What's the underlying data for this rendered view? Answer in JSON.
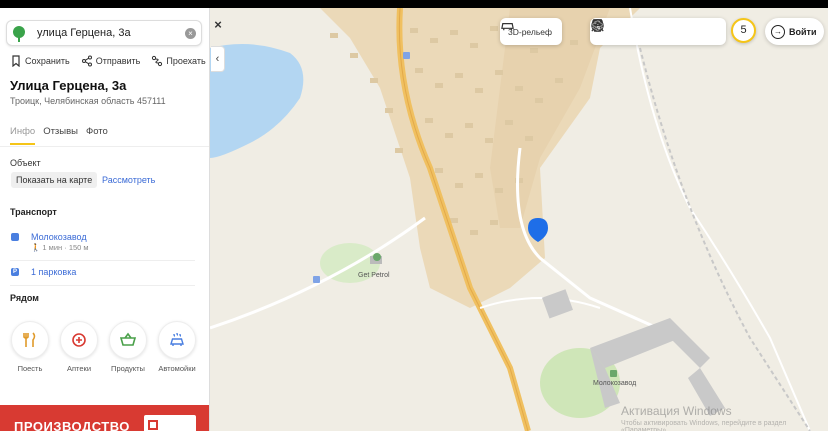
{
  "search": {
    "value": "улица Герцена, 3а"
  },
  "actions": {
    "save": "Сохранить",
    "share": "Отправить",
    "route": "Проехать"
  },
  "place": {
    "title": "Улица Герцена, 3а",
    "address": "Троицк, Челябинская область   457111"
  },
  "tabs": [
    "Инфо",
    "Отзывы",
    "Фото"
  ],
  "object": {
    "label": "Объект",
    "show_on_map": "Показать на карте",
    "route_link": "Рассмотреть"
  },
  "transport": {
    "title": "Транспорт",
    "stop_name": "Молокозавод",
    "stop_meta": "🚶 1 мин · 150 м",
    "parking": "1 парковка"
  },
  "nearby": {
    "title": "Рядом",
    "categories": [
      {
        "label": "Поесть",
        "icon": "food-icon"
      },
      {
        "label": "Аптеки",
        "icon": "pharmacy-icon"
      },
      {
        "label": "Продукты",
        "icon": "basket-icon"
      },
      {
        "label": "Автомойки",
        "icon": "carwash-icon"
      }
    ]
  },
  "ad": {
    "text": "ПРОИЗВОДСТВО"
  },
  "map_controls": {
    "relief": "3D-рельеф",
    "badge": "5",
    "login": "Войти"
  },
  "map_labels": {
    "gas": "Get Petrol",
    "factory": "Молокозавод"
  },
  "watermark": {
    "title": "Активация Windows",
    "sub": "Чтобы активировать Windows, перейдите в раздел «Параметры»."
  },
  "colors": {
    "pin": "#1e6ee8",
    "road": "#f0c060",
    "water": "#b3d6f2",
    "accent": "#f5c518",
    "ad": "#d83a32"
  }
}
